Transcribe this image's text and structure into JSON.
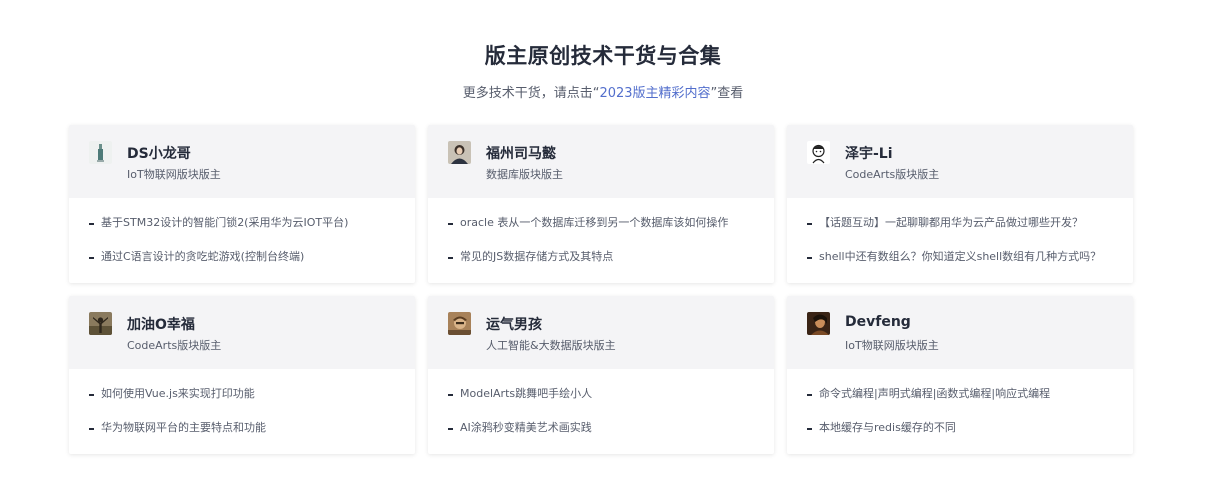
{
  "header": {
    "title": "版主原创技术干货与合集",
    "subtitle_prefix": "更多技术干货，请点击“",
    "subtitle_link": "2023版主精彩内容",
    "subtitle_suffix": "”查看"
  },
  "cards": [
    {
      "name": "DS小龙哥",
      "role": "IoT物联网版块版主",
      "avatar_icon": "figure-avatar-icon",
      "items": [
        "基于STM32设计的智能门锁2(采用华为云IOT平台)",
        "通过C语言设计的贪吃蛇游戏(控制台终端)"
      ]
    },
    {
      "name": "福州司马懿",
      "role": "数据库版块版主",
      "avatar_icon": "girl-avatar-icon",
      "items": [
        "oracle 表从一个数据库迁移到另一个数据库该如何操作",
        "常见的JS数据存储方式及其特点"
      ]
    },
    {
      "name": "泽宇-Li",
      "role": "CodeArts版块版主",
      "avatar_icon": "cartoon-avatar-icon",
      "items": [
        "【话题互动】一起聊聊都用华为云产品做过哪些开发？",
        "shell中还有数组么？你知道定义shell数组有几种方式吗？"
      ]
    },
    {
      "name": "加油O幸福",
      "role": "CodeArts版块版主",
      "avatar_icon": "person-avatar-icon",
      "items": [
        "如何使用Vue.js来实现打印功能",
        "华为物联网平台的主要特点和功能"
      ]
    },
    {
      "name": "运气男孩",
      "role": "人工智能&大数据版块版主",
      "avatar_icon": "photo-avatar-icon",
      "items": [
        "ModelArts跳舞吧手绘小人",
        "AI涂鸦秒变精美艺术画实践"
      ]
    },
    {
      "name": "Devfeng",
      "role": "IoT物联网版块版主",
      "avatar_icon": "portrait-avatar-icon",
      "items": [
        "命令式编程|声明式编程|函数式编程|响应式编程",
        "本地缓存与redis缓存的不同"
      ]
    }
  ]
}
